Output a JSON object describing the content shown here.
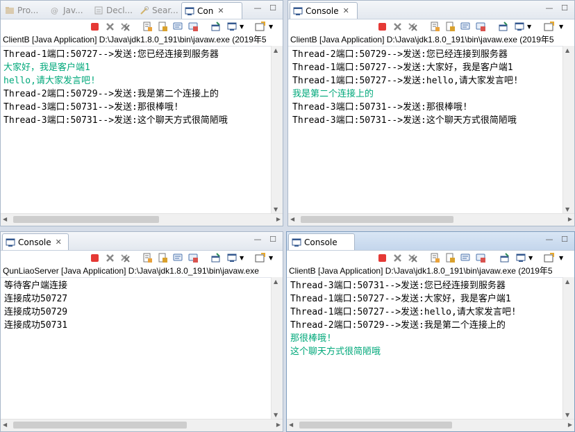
{
  "panels": [
    {
      "id": "top-left",
      "tabs": [
        {
          "label": "Pro...",
          "icon": "project-explorer-icon"
        },
        {
          "label": "Jav...",
          "icon": "javadoc-icon"
        },
        {
          "label": "Decl...",
          "icon": "declaration-icon"
        },
        {
          "label": "Sear...",
          "icon": "search-icon"
        },
        {
          "label": "Con",
          "icon": "console-icon",
          "active": true
        }
      ],
      "description": "ClientB [Java Application] D:\\Java\\jdk1.8.0_191\\bin\\javaw.exe (2019年5",
      "lines": [
        {
          "text": "Thread-1端口:50727-->发送:您已经连接到服务器",
          "type": "out"
        },
        {
          "text": "大家好，我是客户端1",
          "type": "in"
        },
        {
          "text": "hello,请大家发言吧!",
          "type": "in"
        },
        {
          "text": "Thread-2端口:50729-->发送:我是第二个连接上的",
          "type": "out"
        },
        {
          "text": "Thread-3端口:50731-->发送:那很棒哦!",
          "type": "out"
        },
        {
          "text": "Thread-3端口:50731-->发送:这个聊天方式很简陋哦",
          "type": "out"
        }
      ]
    },
    {
      "id": "top-right",
      "tabs": [
        {
          "label": "Console",
          "icon": "console-icon",
          "active": true
        }
      ],
      "description": "ClientB [Java Application] D:\\Java\\jdk1.8.0_191\\bin\\javaw.exe (2019年5",
      "lines": [
        {
          "text": "Thread-2端口:50729-->发送:您已经连接到服务器",
          "type": "out"
        },
        {
          "text": "Thread-1端口:50727-->发送:大家好，我是客户端1",
          "type": "out"
        },
        {
          "text": "Thread-1端口:50727-->发送:hello,请大家发言吧!",
          "type": "out"
        },
        {
          "text": "我是第二个连接上的",
          "type": "in"
        },
        {
          "text": "Thread-3端口:50731-->发送:那很棒哦!",
          "type": "out"
        },
        {
          "text": "Thread-3端口:50731-->发送:这个聊天方式很简陋哦",
          "type": "out"
        }
      ]
    },
    {
      "id": "bottom-left",
      "tabs": [
        {
          "label": "Console",
          "icon": "console-icon",
          "active": true
        }
      ],
      "description": "QunLiaoServer [Java Application] D:\\Java\\jdk1.8.0_191\\bin\\javaw.exe",
      "lines": [
        {
          "text": "等待客户端连接",
          "type": "out"
        },
        {
          "text": "连接成功50727",
          "type": "out"
        },
        {
          "text": "连接成功50729",
          "type": "out"
        },
        {
          "text": "连接成功50731",
          "type": "out"
        }
      ]
    },
    {
      "id": "bottom-right",
      "tabs": [
        {
          "label": "Console",
          "icon": "console-icon",
          "active": true
        }
      ],
      "description": "ClientB [Java Application] D:\\Java\\jdk1.8.0_191\\bin\\javaw.exe (2019年5",
      "lines": [
        {
          "text": "Thread-3端口:50731-->发送:您已经连接到服务器",
          "type": "out"
        },
        {
          "text": "Thread-1端口:50727-->发送:大家好，我是客户端1",
          "type": "out"
        },
        {
          "text": "Thread-1端口:50727-->发送:hello,请大家发言吧!",
          "type": "out"
        },
        {
          "text": "Thread-2端口:50729-->发送:我是第二个连接上的",
          "type": "out"
        },
        {
          "text": "那很棒哦!",
          "type": "in"
        },
        {
          "text": "这个聊天方式很简陋哦",
          "type": "in"
        }
      ]
    }
  ],
  "toolbar_icons": [
    "terminate-icon",
    "remove-launch-icon",
    "remove-all-terminated-icon",
    "clear-console-icon",
    "scroll-lock-icon",
    "word-wrap-icon",
    "show-console-on-output-icon",
    "pin-console-icon",
    "display-selected-console-icon",
    "open-console-icon"
  ],
  "colors": {
    "stdout": "#000000",
    "stdin": "#00a87a",
    "terminate": "#e53935"
  }
}
